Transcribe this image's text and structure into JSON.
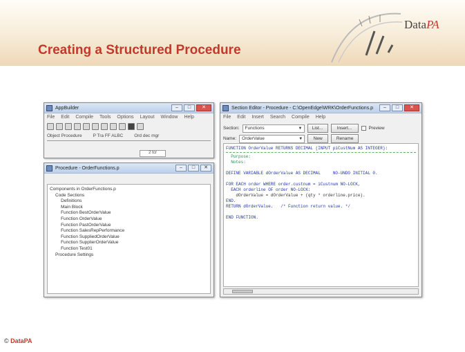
{
  "slide": {
    "title": "Creating a Structured Procedure",
    "logo_main": "Data",
    "logo_accent": "PA",
    "footer_symbol": "©",
    "footer_brand": "DataPA"
  },
  "appbuilder": {
    "title": "AppBuilder",
    "menu": [
      "File",
      "Edit",
      "Compile",
      "Tools",
      "Options",
      "Layout",
      "Window",
      "Help"
    ],
    "field_left": "Object  Procedure",
    "field_mid": "P  Tra  FF  ALBC",
    "field_right": "Ord  dec  mgr",
    "status_value": "2 tcr"
  },
  "procedure_window": {
    "title": "Procedure - OrderFunctions.p",
    "tree": [
      "Components in OrderFunctions.p",
      "Code Sections",
      "Definitions",
      "Main Block",
      "Function BestOrderValue",
      "Function OrderValue",
      "Function PastOrderValue",
      "Function SalesRepPerformance",
      "Function SuppliedOrderValue",
      "Function SupplierOrderValue",
      "Function Test01",
      "Procedure Settings"
    ]
  },
  "section_editor": {
    "title": "Section Editor - Procedure - C:\\OpenEdge\\WRK\\OrderFunctions.p",
    "menu": [
      "File",
      "Edit",
      "Insert",
      "Search",
      "Compile",
      "Help"
    ],
    "section_label": "Section:",
    "section_value": "Functions",
    "name_label": "Name:",
    "name_value": "OrderValue",
    "buttons": [
      "List...",
      "New",
      "Rename",
      "Insert..."
    ],
    "preview_label": "Preview",
    "code_lines": [
      "FUNCTION OrderValue RETURNS DECIMAL (INPUT piCustNum AS INTEGER):",
      "  Purpose:",
      "  Notes:",
      "DEFINE VARIABLE dOrderValue AS DECIMAL     NO-UNDO INITIAL 0.",
      "FOR EACH order WHERE order.custnum = iCustnum NO-LOCK,",
      "  EACH orderline OF order NO-LOCK:",
      "    dOrderValue = dOrderValue + (qty * orderline.price).",
      "END.",
      "RETURN dOrderValue.   /* Function return value. */",
      "END FUNCTION."
    ]
  }
}
